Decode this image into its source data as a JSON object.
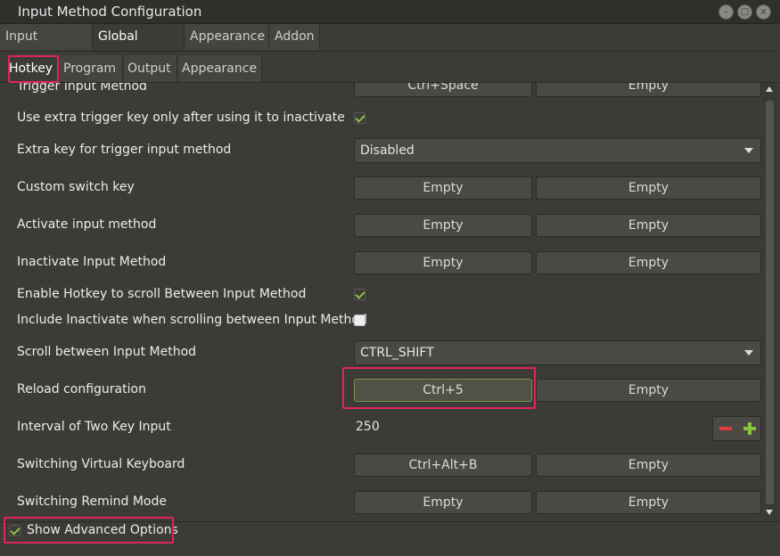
{
  "window": {
    "title": "Input Method Configuration",
    "buttons": [
      "minimize",
      "maximize",
      "close"
    ]
  },
  "top_tabs": [
    "Input Method",
    "Global Config",
    "Appearance",
    "Addon"
  ],
  "sub_tabs": [
    "Hotkey",
    "Program",
    "Output",
    "Appearance"
  ],
  "rows": {
    "trigger": {
      "label": "Trigger Input Method",
      "key1": "Ctrl+Space",
      "key2": "Empty"
    },
    "extra_trigger_only": {
      "label": "Use extra trigger key only after using it to inactivate",
      "checked": true
    },
    "extra_key": {
      "label": "Extra key for trigger input method",
      "value": "Disabled"
    },
    "custom_switch": {
      "label": "Custom switch key",
      "key1": "Empty",
      "key2": "Empty"
    },
    "activate": {
      "label": "Activate input method",
      "key1": "Empty",
      "key2": "Empty"
    },
    "inactivate": {
      "label": "Inactivate Input Method",
      "key1": "Empty",
      "key2": "Empty"
    },
    "enable_scroll": {
      "label": "Enable Hotkey to scroll Between Input Method",
      "checked": true
    },
    "include_inactivate": {
      "label": "Include Inactivate when scrolling between Input Method",
      "checked": false
    },
    "scroll_between": {
      "label": "Scroll between Input Method",
      "value": "CTRL_SHIFT"
    },
    "reload": {
      "label": "Reload configuration",
      "key1": "Ctrl+5",
      "key2": "Empty"
    },
    "interval": {
      "label": "Interval of Two Key Input",
      "value": "250"
    },
    "virtual_kb": {
      "label": "Switching Virtual Keyboard",
      "key1": "Ctrl+Alt+B",
      "key2": "Empty"
    },
    "remind": {
      "label": "Switching Remind Mode",
      "key1": "Empty",
      "key2": "Empty"
    }
  },
  "footer": {
    "label": "Show Advanced Options",
    "checked": true
  },
  "colors": {
    "highlight": "#e0245e",
    "check": "#8ac33e",
    "minus": "#e03c3c"
  }
}
